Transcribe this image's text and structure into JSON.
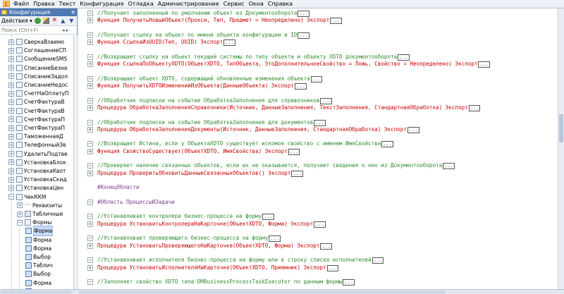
{
  "menu": {
    "items": [
      "Файл",
      "Правка",
      "Текст",
      "Конфигурация",
      "Отладка",
      "Администрирование",
      "Сервис",
      "Окна",
      "Справка"
    ]
  },
  "panel": {
    "title": "Конфигурация",
    "close": "✕",
    "actions_label": "Действия ▾",
    "search_placeholder": "Поиск (Ctrl+F)",
    "search_buttons": "◂ ▸"
  },
  "tree": [
    {
      "label": "СверкаВзаимо",
      "type": "obj",
      "indent": 1,
      "expander": "+"
    },
    {
      "label": "СоглашениеСП",
      "type": "obj",
      "indent": 1,
      "expander": "+"
    },
    {
      "label": "СообщениеSMS",
      "type": "obj",
      "indent": 1,
      "expander": "+"
    },
    {
      "label": "СписаниеБезна",
      "type": "obj",
      "indent": 1,
      "expander": "+"
    },
    {
      "label": "СписаниеЗадол",
      "type": "obj",
      "indent": 1,
      "expander": "+"
    },
    {
      "label": "СписаниеНедос",
      "type": "obj",
      "indent": 1,
      "expander": "+"
    },
    {
      "label": "СчетНаОплатуП",
      "type": "obj",
      "indent": 1,
      "expander": "+"
    },
    {
      "label": "СчетФактураВ",
      "type": "obj",
      "indent": 1,
      "expander": "+"
    },
    {
      "label": "СчетФактураВ",
      "type": "obj",
      "indent": 1,
      "expander": "+"
    },
    {
      "label": "СчетФактураП",
      "type": "obj",
      "indent": 1,
      "expander": "+"
    },
    {
      "label": "СчетФактураП",
      "type": "obj",
      "indent": 1,
      "expander": "+"
    },
    {
      "label": "ТаможеннаяД",
      "type": "obj",
      "indent": 1,
      "expander": "+"
    },
    {
      "label": "ТелефонныйЗв",
      "type": "obj",
      "indent": 1,
      "expander": "+"
    },
    {
      "label": "УдалитьПодтве",
      "type": "obj",
      "indent": 1,
      "expander": "+"
    },
    {
      "label": "УстановкаБлок",
      "type": "obj",
      "indent": 1,
      "expander": "+"
    },
    {
      "label": "УстановкаКвот",
      "type": "obj",
      "indent": 1,
      "expander": "+"
    },
    {
      "label": "УстановкаСкид",
      "type": "obj",
      "indent": 1,
      "expander": "+"
    },
    {
      "label": "УстановкаЦен",
      "type": "obj",
      "indent": 1,
      "expander": "+"
    },
    {
      "label": "ЧекККМ",
      "type": "obj",
      "indent": 1,
      "expander": "−"
    },
    {
      "label": "Реквизиты",
      "type": "prop",
      "indent": 2,
      "expander": "+"
    },
    {
      "label": "Табличные",
      "type": "table",
      "indent": 2,
      "expander": "+"
    },
    {
      "label": "Формы",
      "type": "obj",
      "indent": 2,
      "expander": "−"
    },
    {
      "label": "Форма",
      "type": "form",
      "indent": 3,
      "expander": "",
      "selected": true
    },
    {
      "label": "Форма",
      "type": "form",
      "indent": 3,
      "expander": ""
    },
    {
      "label": "Форма",
      "type": "form",
      "indent": 3,
      "expander": ""
    },
    {
      "label": "Выбор",
      "type": "form",
      "indent": 3,
      "expander": ""
    },
    {
      "label": "Таблич",
      "type": "form",
      "indent": 3,
      "expander": ""
    },
    {
      "label": "Выбор",
      "type": "form",
      "indent": 3,
      "expander": ""
    },
    {
      "label": "Форма",
      "type": "form",
      "indent": 3,
      "expander": ""
    },
    {
      "label": "Запрос",
      "type": "form",
      "indent": 3,
      "expander": ""
    }
  ],
  "code": [
    {
      "fold": "−",
      "parts": [
        {
          "c": "c-comment",
          "t": "//Получает заполненный по умолчанию объект из Документооборота"
        }
      ],
      "collapsed": true
    },
    {
      "fold": "+",
      "parts": [
        {
          "c": "c-kw",
          "t": "Функция ПолучитьНовыйОбъект(Прокси, Тип, Предмет = Неопределено) Экспорт"
        }
      ],
      "collapsed": true
    },
    {
      "fold": "",
      "parts": [],
      "collapsed": false
    },
    {
      "fold": "−",
      "parts": [
        {
          "c": "c-comment",
          "t": "//Получает ссылку на объект по имени объекта конфигурации и ID"
        }
      ],
      "collapsed": true
    },
    {
      "fold": "+",
      "parts": [
        {
          "c": "c-kw",
          "t": "Функция СсылкаИзUUID(Тип, UUID) Экспорт"
        }
      ],
      "collapsed": true
    },
    {
      "fold": "",
      "parts": [],
      "collapsed": false
    },
    {
      "fold": "−",
      "parts": [
        {
          "c": "c-comment",
          "t": "//Возвращает ссылку на объект текущей системы по типу объекта и объекту XDTO документооборота"
        }
      ],
      "collapsed": true
    },
    {
      "fold": "+",
      "parts": [
        {
          "c": "c-kw",
          "t": "Функция СсылкаПоОбъектуXDTO(ОбъектXDTO, ТипОбъекта, ЭтоДополнительноеСвойство = Ложь, Свойство = Неопределено) Экспорт"
        }
      ],
      "collapsed": true
    },
    {
      "fold": "",
      "parts": [],
      "collapsed": false
    },
    {
      "fold": "−",
      "parts": [
        {
          "c": "c-comment",
          "t": "//Возвращает объект XDTO, содержащий обновленные изменения объекта"
        }
      ],
      "collapsed": true
    },
    {
      "fold": "+",
      "parts": [
        {
          "c": "c-kw",
          "t": "Функция ПолучитьXDTOИзмененийИзОбъекта(ДанныеОбъекта) Экспорт"
        }
      ],
      "collapsed": true
    },
    {
      "fold": "",
      "parts": [],
      "collapsed": false
    },
    {
      "fold": "−",
      "parts": [
        {
          "c": "c-comment",
          "t": "//Обработчик подписки на событие ОбработкаЗаполнения для справочников"
        }
      ],
      "collapsed": true
    },
    {
      "fold": "+",
      "parts": [
        {
          "c": "c-kw",
          "t": "Процедура ОбработкаЗаполненияСправочники(Источник, ДанныеЗаполнения, ТекстЗаполнения, СтандартнаяОбработка) Экспорт"
        }
      ],
      "collapsed": true
    },
    {
      "fold": "",
      "parts": [],
      "collapsed": false
    },
    {
      "fold": "−",
      "parts": [
        {
          "c": "c-comment",
          "t": "//Обработчик подписки на событие ОбработкаЗаполнения для документов"
        }
      ],
      "collapsed": true
    },
    {
      "fold": "+",
      "parts": [
        {
          "c": "c-kw",
          "t": "Процедура ОбработкаЗаполненияДокументы(Источник, ДанныеЗаполнения, СтандартнаяОбработка) Экспорт"
        }
      ],
      "collapsed": true
    },
    {
      "fold": "",
      "parts": [],
      "collapsed": false
    },
    {
      "fold": "−",
      "parts": [
        {
          "c": "c-comment",
          "t": "//Возвращает Истина, если у ОбъектаXDTO существует искомое свойство с именем ИмяСвойства"
        }
      ],
      "collapsed": true
    },
    {
      "fold": "+",
      "parts": [
        {
          "c": "c-kw",
          "t": "Функция СвойствоСуществует(ОбъектXDTO, ИмяСвойства) Экспорт"
        }
      ],
      "collapsed": true
    },
    {
      "fold": "",
      "parts": [],
      "collapsed": false
    },
    {
      "fold": "−",
      "parts": [
        {
          "c": "c-comment",
          "t": "//Проверяет наличие связанных объектов, если их не оказывается, получает сведения о них из Документооборота"
        }
      ],
      "collapsed": true
    },
    {
      "fold": "+",
      "parts": [
        {
          "c": "c-kw",
          "t": "Процедура ПроверитьОбновитьДанныеСвязанныхОбъектов() Экспорт"
        }
      ],
      "collapsed": true
    },
    {
      "fold": "",
      "parts": [],
      "collapsed": false
    },
    {
      "fold": "",
      "parts": [
        {
          "c": "c-region",
          "t": "#КонецОбласти"
        }
      ],
      "collapsed": false
    },
    {
      "fold": "",
      "parts": [],
      "collapsed": false
    },
    {
      "fold": "−",
      "parts": [
        {
          "c": "c-region",
          "t": "#Область ПроцессыИЗадачи"
        }
      ],
      "collapsed": false
    },
    {
      "fold": "",
      "parts": [],
      "collapsed": false
    },
    {
      "fold": "−",
      "parts": [
        {
          "c": "c-comment",
          "t": "//Устанавливает контролера бизнес-процесса на форму"
        }
      ],
      "collapsed": true
    },
    {
      "fold": "+",
      "parts": [
        {
          "c": "c-kw",
          "t": "Процедура УстановитьКонтролераНаКарточке(ОбъектXDTO, Форма) Экспорт"
        }
      ],
      "collapsed": true
    },
    {
      "fold": "",
      "parts": [],
      "collapsed": false
    },
    {
      "fold": "−",
      "parts": [
        {
          "c": "c-comment",
          "t": "//Устанавливает проверяющего бизнес-процесса на форму"
        }
      ],
      "collapsed": true
    },
    {
      "fold": "+",
      "parts": [
        {
          "c": "c-kw",
          "t": "Процедура УстановитьПроверяющегоНаКарточке(ОбъектXDTO, Форма) Экспорт"
        }
      ],
      "collapsed": true
    },
    {
      "fold": "",
      "parts": [],
      "collapsed": false
    },
    {
      "fold": "−",
      "parts": [
        {
          "c": "c-comment",
          "t": "//Устанавливает исполнителя бизнес-процесса на форму или в строку списка исполнителей"
        }
      ],
      "collapsed": true
    },
    {
      "fold": "+",
      "parts": [
        {
          "c": "c-kw",
          "t": "Процедура УстановитьИсполнителяНаКарточке(ОбъектXDTO, Приемник) Экспорт"
        }
      ],
      "collapsed": true
    },
    {
      "fold": "",
      "parts": [],
      "collapsed": false
    },
    {
      "fold": "−",
      "parts": [
        {
          "c": "c-comment",
          "t": "//Заполняет свойство XDTO типа DMBusinessProcessTaskExecutor по данным формы"
        }
      ],
      "collapsed": true
    }
  ]
}
